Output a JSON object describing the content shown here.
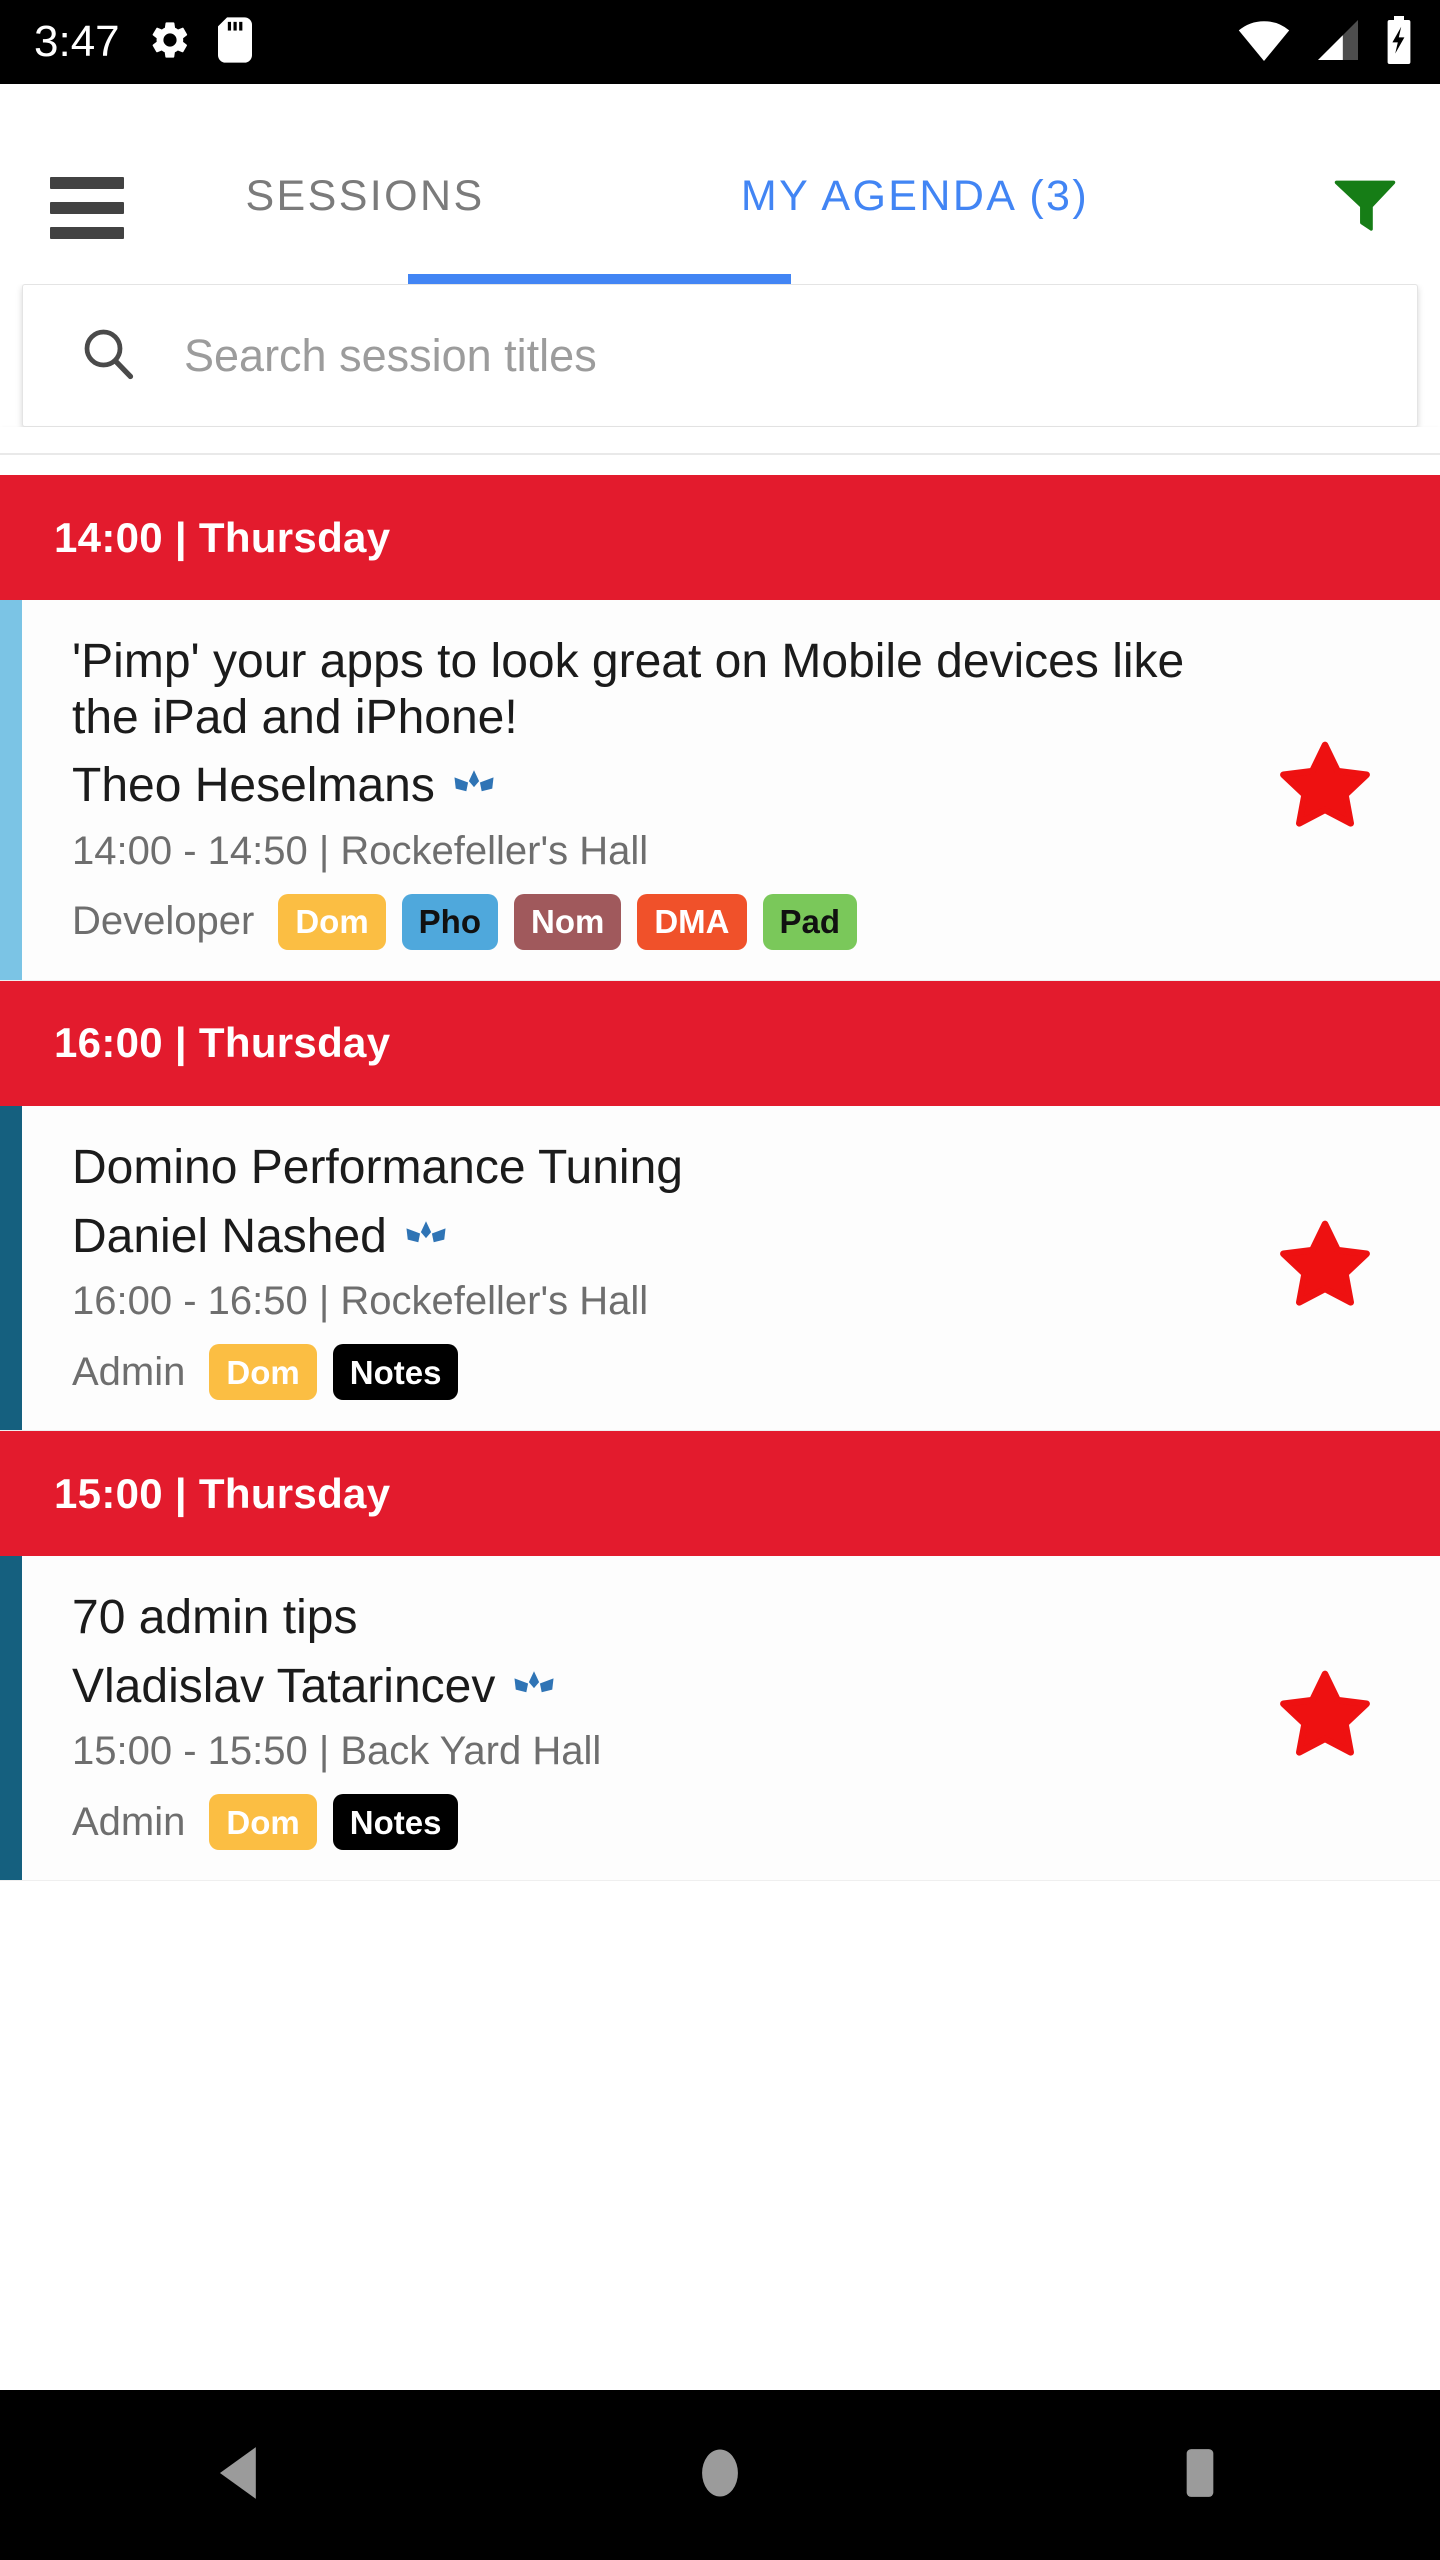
{
  "status_bar": {
    "time": "3:47",
    "left_icons": [
      "gear-icon",
      "sd-card-icon"
    ],
    "right_icons": [
      "wifi-icon",
      "cellular-signal-icon",
      "battery-charging-icon"
    ]
  },
  "header": {
    "menu_icon": "hamburger-menu-icon",
    "filter_icon": "filter-funnel-icon",
    "filter_color": "#167D16",
    "active_tab_color": "#4285F4",
    "inactive_tab_color": "#7B7B7B",
    "tabs": [
      {
        "label": "SESSIONS",
        "active": false
      },
      {
        "label": "MY AGENDA (3)",
        "active": true
      }
    ]
  },
  "search": {
    "icon": "search-icon",
    "placeholder": "Search session titles",
    "value": ""
  },
  "agenda": {
    "groups": [
      {
        "header": "14:00 | Thursday",
        "header_color": "#E31B2D",
        "session": {
          "title": "'Pimp' your apps to look great on Mobile devices like the iPad and iPhone!",
          "speaker": "Theo Heselmans",
          "speaker_badge": "champion-crown-icon",
          "meta": "14:00 - 14:50 | Rockefeller's Hall",
          "track": "Developer",
          "accent_color": "#7BC4E5",
          "starred": true,
          "star_color": "#EE1111",
          "tags": [
            {
              "label": "Dom",
              "bg": "#FBBE43",
              "fg": "#FFFFFF"
            },
            {
              "label": "Pho",
              "bg": "#4FA8DC",
              "fg": "#111111"
            },
            {
              "label": "Nom",
              "bg": "#A0595C",
              "fg": "#FFFFFF"
            },
            {
              "label": "DMA",
              "bg": "#F0512A",
              "fg": "#FFFFFF"
            },
            {
              "label": "Pad",
              "bg": "#7AC85A",
              "fg": "#111111"
            }
          ]
        }
      },
      {
        "header": "16:00 | Thursday",
        "header_color": "#E31B2D",
        "session": {
          "title": "Domino Performance Tuning",
          "speaker": "Daniel Nashed",
          "speaker_badge": "champion-crown-icon",
          "meta": "16:00 - 16:50 | Rockefeller's Hall",
          "track": "Admin",
          "accent_color": "#15607F",
          "starred": true,
          "star_color": "#EE1111",
          "tags": [
            {
              "label": "Dom",
              "bg": "#FBBE43",
              "fg": "#FFFFFF"
            },
            {
              "label": "Notes",
              "bg": "#000000",
              "fg": "#FFFFFF"
            }
          ]
        }
      },
      {
        "header": "15:00 | Thursday",
        "header_color": "#E31B2D",
        "session": {
          "title": "70 admin tips",
          "speaker": "Vladislav Tatarincev",
          "speaker_badge": "champion-crown-icon",
          "meta": "15:00 - 15:50 | Back Yard Hall",
          "track": "Admin",
          "accent_color": "#15607F",
          "starred": true,
          "star_color": "#EE1111",
          "tags": [
            {
              "label": "Dom",
              "bg": "#FBBE43",
              "fg": "#FFFFFF"
            },
            {
              "label": "Notes",
              "bg": "#000000",
              "fg": "#FFFFFF"
            }
          ]
        }
      }
    ]
  },
  "navigation_bar": {
    "buttons": [
      "back-icon",
      "home-icon",
      "recents-icon"
    ],
    "icon_color": "#9B9B9B"
  }
}
